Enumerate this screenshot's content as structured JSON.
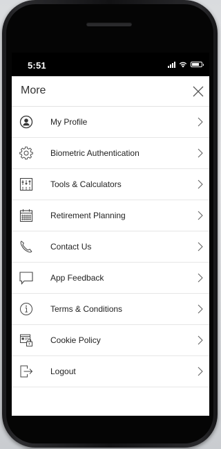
{
  "status_bar": {
    "time": "5:51",
    "battery_level": 0.75
  },
  "header": {
    "title": "More",
    "close_icon": "close-icon"
  },
  "menu": {
    "items": [
      {
        "label": "My Profile",
        "icon": "profile-icon"
      },
      {
        "label": "Biometric Authentication",
        "icon": "gear-icon"
      },
      {
        "label": "Tools & Calculators",
        "icon": "calculator-icon"
      },
      {
        "label": "Retirement Planning",
        "icon": "calendar-icon"
      },
      {
        "label": "Contact Us",
        "icon": "phone-icon"
      },
      {
        "label": "App Feedback",
        "icon": "feedback-icon"
      },
      {
        "label": "Terms & Conditions",
        "icon": "info-icon"
      },
      {
        "label": "Cookie Policy",
        "icon": "cookie-lock-icon"
      },
      {
        "label": "Logout",
        "icon": "logout-icon"
      }
    ]
  },
  "colors": {
    "icon": "#555555",
    "text": "#222222",
    "divider": "#e6e6e6"
  }
}
